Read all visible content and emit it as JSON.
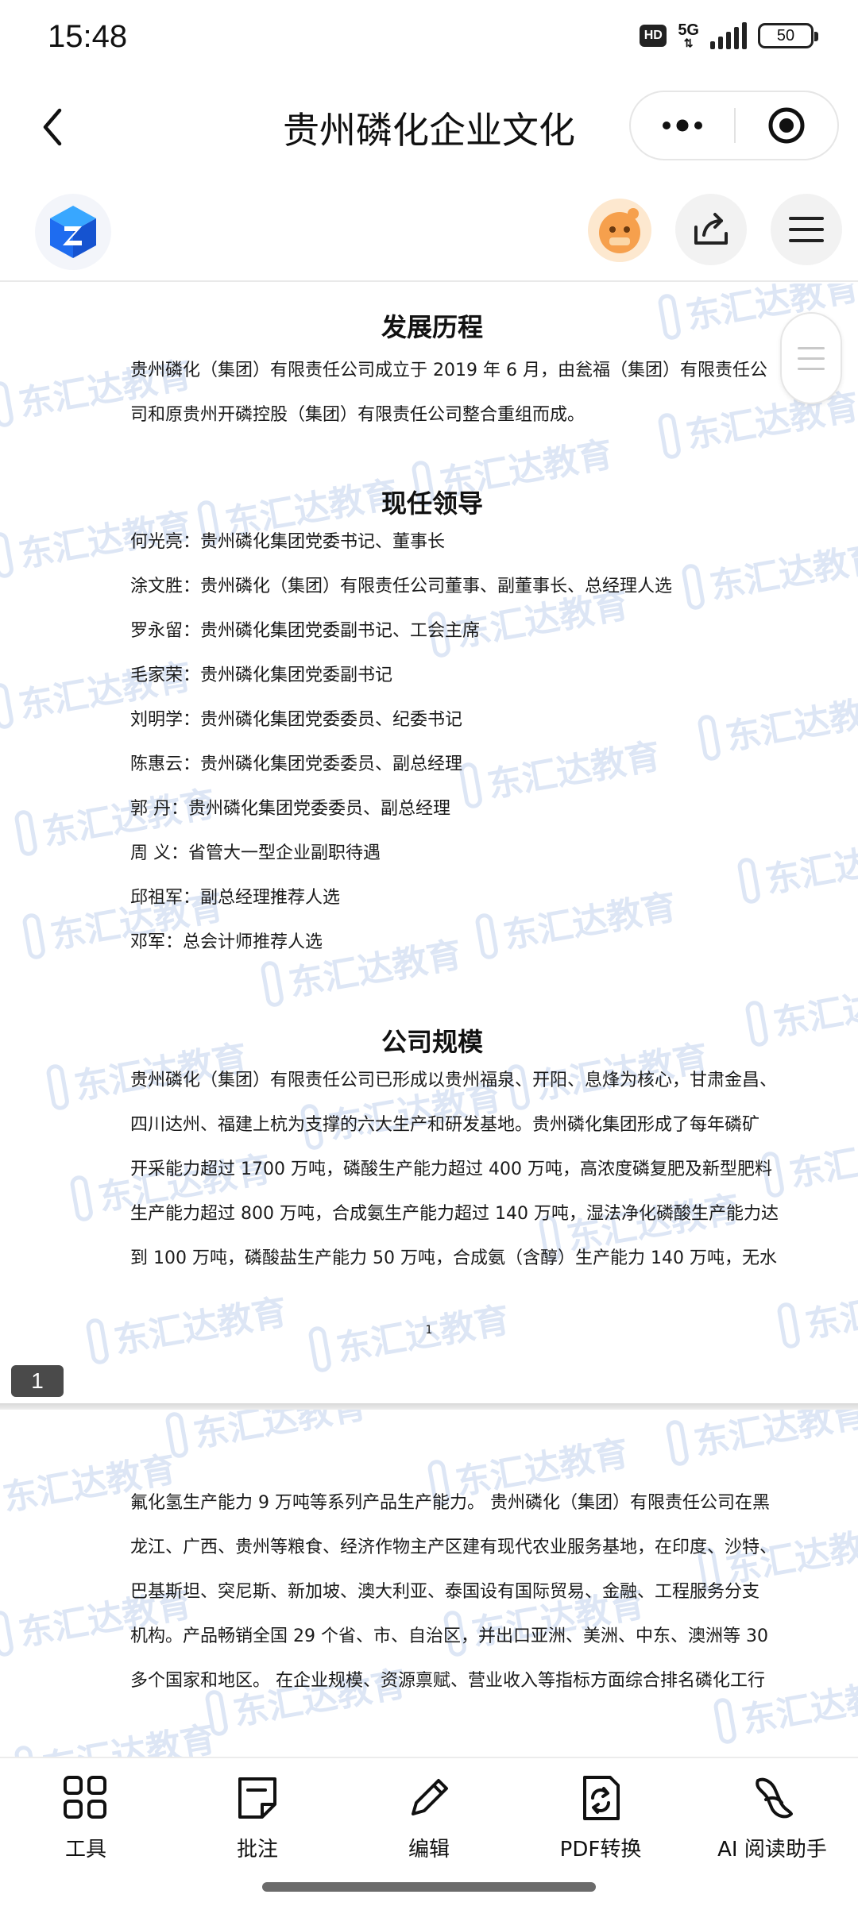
{
  "status_bar": {
    "time": "15:48",
    "hd": "HD",
    "network": "5G",
    "battery": "50"
  },
  "nav": {
    "title": "贵州磷化企业文化"
  },
  "watermark": "东汇达教育",
  "page1": {
    "sections": {
      "history": {
        "title": "发展历程",
        "lines": [
          "贵州磷化（集团）有限责任公司成立于 2019 年 6 月，由瓮福（集团）有限责任公",
          "司和原贵州开磷控股（集团）有限责任公司整合重组而成。"
        ]
      },
      "leaders": {
        "title": "现任领导",
        "lines": [
          "何光亮：贵州磷化集团党委书记、董事长",
          "涂文胜：贵州磷化（集团）有限责任公司董事、副董事长、总经理人选",
          "罗永留：贵州磷化集团党委副书记、工会主席",
          "毛家荣：贵州磷化集团党委副书记",
          "刘明学：贵州磷化集团党委委员、纪委书记",
          "陈惠云：贵州磷化集团党委委员、副总经理",
          "郭 丹：贵州磷化集团党委委员、副总经理",
          "周 义：省管大一型企业副职待遇",
          "邱祖军：副总经理推荐人选",
          "邓军：总会计师推荐人选"
        ]
      },
      "scale": {
        "title": "公司规模",
        "lines": [
          "贵州磷化（集团）有限责任公司已形成以贵州福泉、开阳、息烽为核心，甘肃金昌、",
          "四川达州、福建上杭为支撑的六大生产和研发基地。贵州磷化集团形成了每年磷矿",
          "开采能力超过 1700 万吨，磷酸生产能力超过 400 万吨，高浓度磷复肥及新型肥料",
          "生产能力超过 800 万吨，合成氨生产能力超过 140 万吨，湿法净化磷酸生产能力达",
          "到 100 万吨，磷酸盐生产能力 50 万吨，合成氨（含醇）生产能力 140 万吨，无水"
        ]
      }
    },
    "page_number": "1",
    "page_badge": "1"
  },
  "page2": {
    "lines": [
      "氟化氢生产能力 9 万吨等系列产品生产能力。 贵州磷化（集团）有限责任公司在黑",
      "龙江、广西、贵州等粮食、经济作物主产区建有现代农业服务基地，在印度、沙特、",
      "巴基斯坦、突尼斯、新加坡、澳大利亚、泰国设有国际贸易、金融、工程服务分支",
      "机构。产品畅销全国 29 个省、市、自治区，并出口亚洲、美洲、中东、澳洲等 30",
      "多个国家和地区。 在企业规模、资源禀赋、营业收入等指标方面综合排名磷化工行"
    ]
  },
  "bottom_bar": {
    "items": [
      {
        "label": "工具",
        "icon": "grid-tools-icon"
      },
      {
        "label": "批注",
        "icon": "annotate-icon"
      },
      {
        "label": "编辑",
        "icon": "pencil-icon"
      },
      {
        "label": "PDF转换",
        "icon": "pdf-convert-icon"
      },
      {
        "label": "AI 阅读助手",
        "icon": "ai-assistant-icon"
      }
    ]
  },
  "colors": {
    "watermark": "#dde6f5",
    "logo_blue": "#1e6cf0",
    "page_badge": "#4a4a4a"
  }
}
